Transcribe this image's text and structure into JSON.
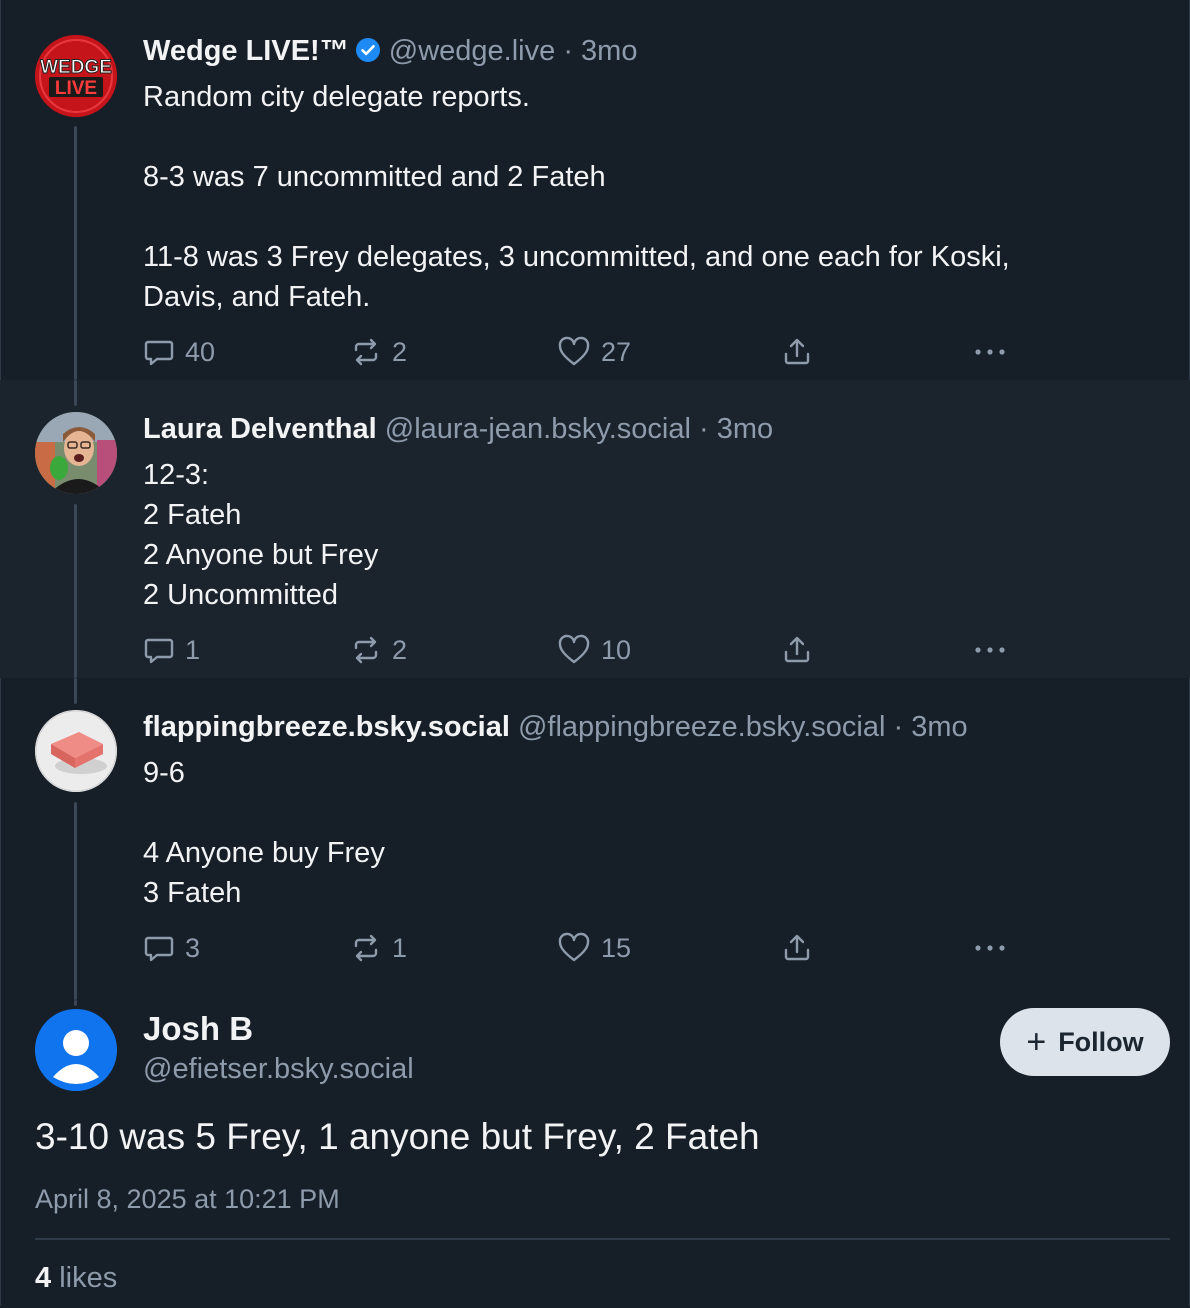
{
  "posts": [
    {
      "name": "Wedge LIVE!™",
      "handle": "@wedge.live",
      "sep": "·",
      "time": "3mo",
      "lines": [
        "Random city delegate reports.",
        "",
        "8-3 was 7 uncommitted and 2 Fateh",
        "",
        "11-8 was 3 Frey delegates, 3 uncommitted, and one each for Koski,",
        "Davis, and Fateh."
      ],
      "replies": "40",
      "reposts": "2",
      "likes": "27",
      "avatar_text_top": "WEDGE",
      "avatar_text_bottom": "LIVE"
    },
    {
      "name": "Laura Delventhal",
      "handle": "@laura-jean.bsky.social",
      "sep": "·",
      "time": "3mo",
      "lines": [
        "12-3:",
        "2 Fateh",
        "2 Anyone but Frey",
        "2 Uncommitted"
      ],
      "replies": "1",
      "reposts": "2",
      "likes": "10"
    },
    {
      "name": "flappingbreeze.bsky.social",
      "handle": "@flappingbreeze.bsky.social",
      "sep": "·",
      "time": "3mo",
      "lines": [
        "9-6",
        "",
        "4 Anyone buy Frey",
        "3 Fateh"
      ],
      "replies": "3",
      "reposts": "1",
      "likes": "15"
    }
  ],
  "main_post": {
    "name": "Josh B",
    "handle": "@efietser.bsky.social",
    "follow_label": "Follow",
    "text": "3-10 was 5 Frey, 1 anyone but Frey, 2 Fateh",
    "timestamp": "April 8, 2025 at 10:21 PM",
    "likes_count": "4",
    "likes_label": "likes"
  },
  "icons": {
    "reply": "speech-bubble-icon",
    "repost": "repost-arrows-icon",
    "like": "heart-icon",
    "share": "share-upload-icon",
    "more": "more-dots-icon",
    "verified": "verified-check-icon",
    "follow": "plus-icon"
  },
  "colors": {
    "background": "#161e27",
    "alt_background": "#1b232d",
    "muted_text": "#8e9bab",
    "verified_blue": "#1d8af5",
    "follow_button_bg": "#dde3ea",
    "default_avatar_blue": "#1174ef"
  }
}
